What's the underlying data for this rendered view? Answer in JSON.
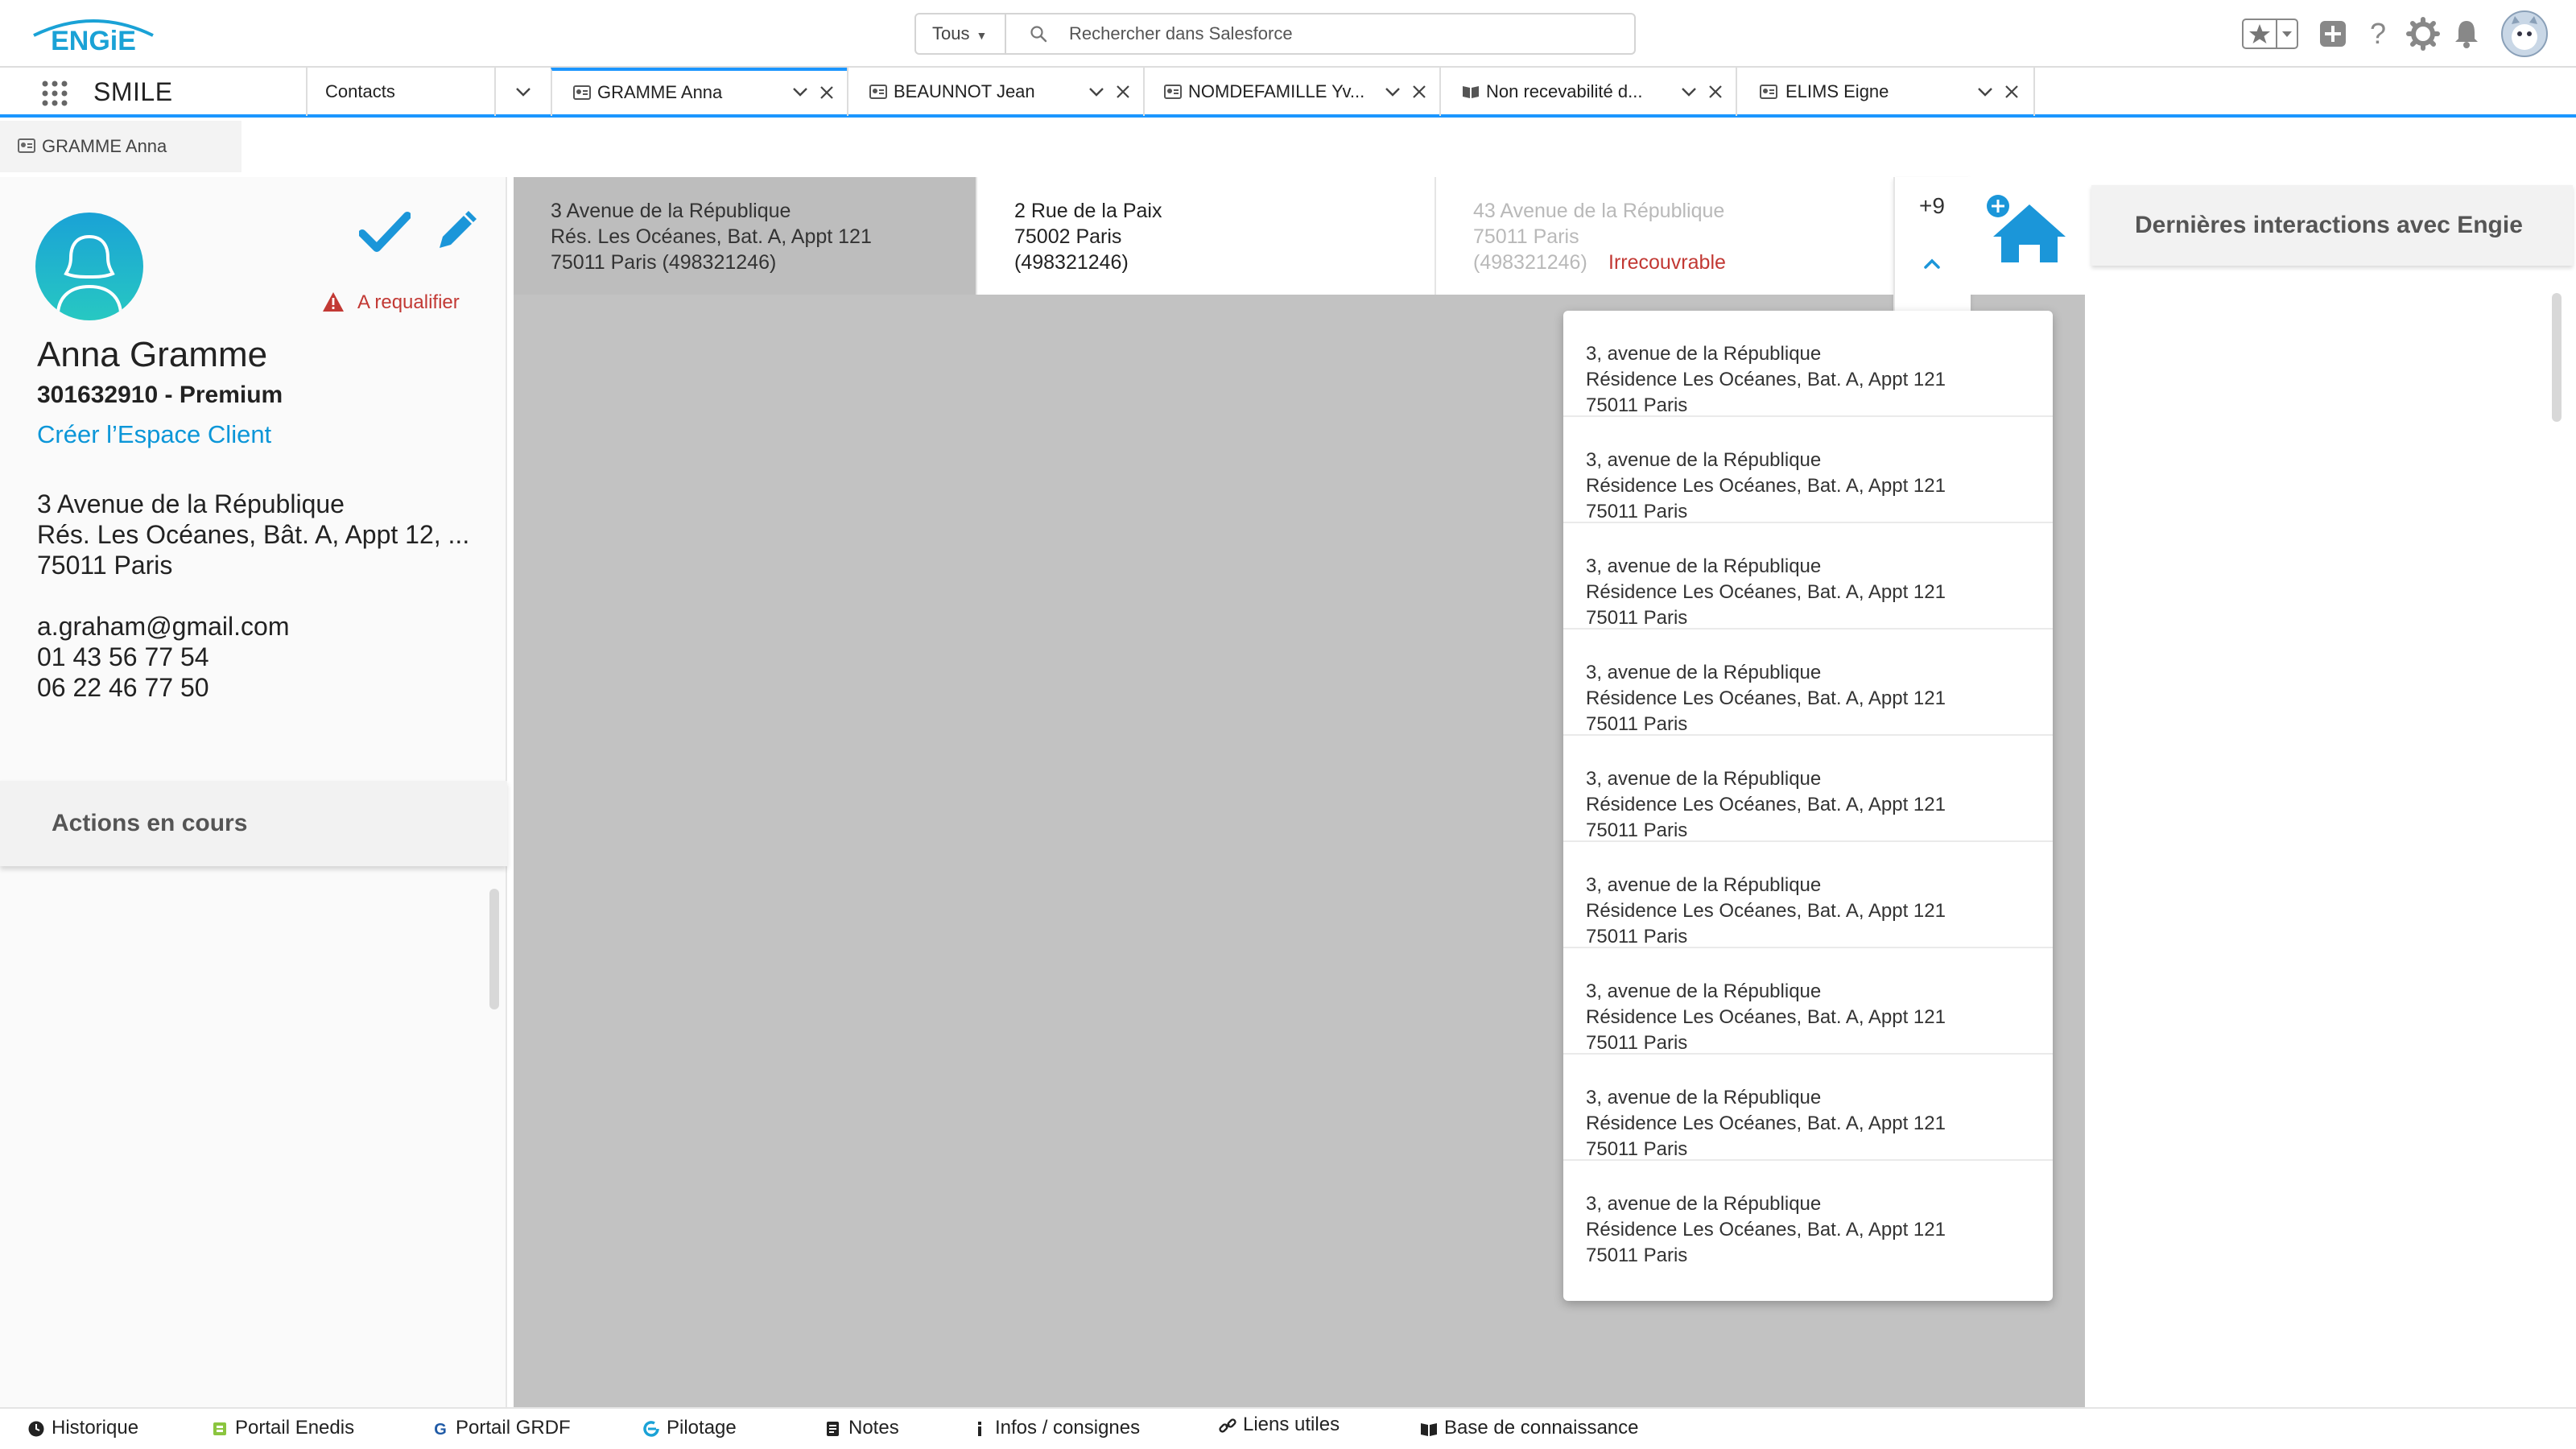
{
  "header": {
    "logo_text": "ENGiE",
    "search_scope": "Tous",
    "search_placeholder": "Rechercher dans Salesforce"
  },
  "tabbar": {
    "app_name": "SMILE",
    "tabs": [
      {
        "label": "Contacts"
      },
      {
        "label": "GRAMME Anna"
      },
      {
        "label": "BEAUNNOT Jean"
      },
      {
        "label": "NOMDEFAMILLE Yv..."
      },
      {
        "label": "Non recevabilité d..."
      },
      {
        "label": "ELIMS Eigne"
      }
    ]
  },
  "subtab": {
    "label": "GRAMME Anna"
  },
  "contact": {
    "status": "A requalifier",
    "name": "Anna Gramme",
    "id_line": "301632910 - Premium",
    "create_space": "Créer l’Espace Client",
    "address_lines": [
      "3 Avenue de la République",
      "Rés. Les Océanes, Bât. A, Appt 12, ...",
      "75011 Paris"
    ],
    "email": "a.graham@gmail.com",
    "phone_1": "01 43 56 77 54",
    "phone_2": "06 22 46 77 50",
    "actions_title": "Actions en cours"
  },
  "addresses": [
    {
      "line1": "3 Avenue de la République",
      "line2": "Rés. Les Océanes, Bat. A, Appt 121",
      "line3": "75011 Paris (498321246)"
    },
    {
      "line1": "2 Rue de la Paix",
      "line2": "75002 Paris",
      "line3": "(498321246)"
    },
    {
      "line1": "43 Avenue de la République",
      "line2": "75011 Paris",
      "line3": "(498321246)",
      "status": "Irrecouvrable"
    }
  ],
  "more_count": "+9",
  "dropdown": [
    {
      "l1": "3, avenue de la République",
      "l2": "Résidence Les Océanes, Bat. A, Appt 121",
      "l3": "75011 Paris"
    },
    {
      "l1": "3, avenue de la République",
      "l2": "Résidence Les Océanes, Bat. A, Appt 121",
      "l3": "75011 Paris"
    },
    {
      "l1": "3, avenue de la République",
      "l2": "Résidence Les Océanes, Bat. A, Appt 121",
      "l3": "75011 Paris"
    },
    {
      "l1": "3, avenue de la République",
      "l2": "Résidence Les Océanes, Bat. A, Appt 121",
      "l3": "75011 Paris"
    },
    {
      "l1": "3, avenue de la République",
      "l2": "Résidence Les Océanes, Bat. A, Appt 121",
      "l3": "75011 Paris"
    },
    {
      "l1": "3, avenue de la République",
      "l2": "Résidence Les Océanes, Bat. A, Appt 121",
      "l3": "75011 Paris"
    },
    {
      "l1": "3, avenue de la République",
      "l2": "Résidence Les Océanes, Bat. A, Appt 121",
      "l3": "75011 Paris"
    },
    {
      "l1": "3, avenue de la République",
      "l2": "Résidence Les Océanes, Bat. A, Appt 121",
      "l3": "75011 Paris"
    },
    {
      "l1": "3, avenue de la République",
      "l2": "Résidence Les Océanes, Bat. A, Appt 121",
      "l3": "75011 Paris"
    }
  ],
  "right_panel": {
    "title": "Dernières interactions avec Engie"
  },
  "utility_bar": [
    {
      "label": "Historique",
      "icon": "clock-icon"
    },
    {
      "label": "Portail Enedis",
      "icon": "enedis-icon"
    },
    {
      "label": "Portail GRDF",
      "icon": "grdf-icon"
    },
    {
      "label": "Pilotage",
      "icon": "pilotage-icon"
    },
    {
      "label": "Notes",
      "icon": "notes-icon"
    },
    {
      "label": "Infos / consignes",
      "icon": "info-icon"
    },
    {
      "label": "Liens utiles",
      "icon": "link-icon"
    },
    {
      "label": "Base de connaissance",
      "icon": "book-icon"
    }
  ],
  "colors": {
    "accent": "#1b96ff",
    "link": "#0b96d8",
    "alert": "#c23934",
    "brand": "#1aa2d6"
  }
}
